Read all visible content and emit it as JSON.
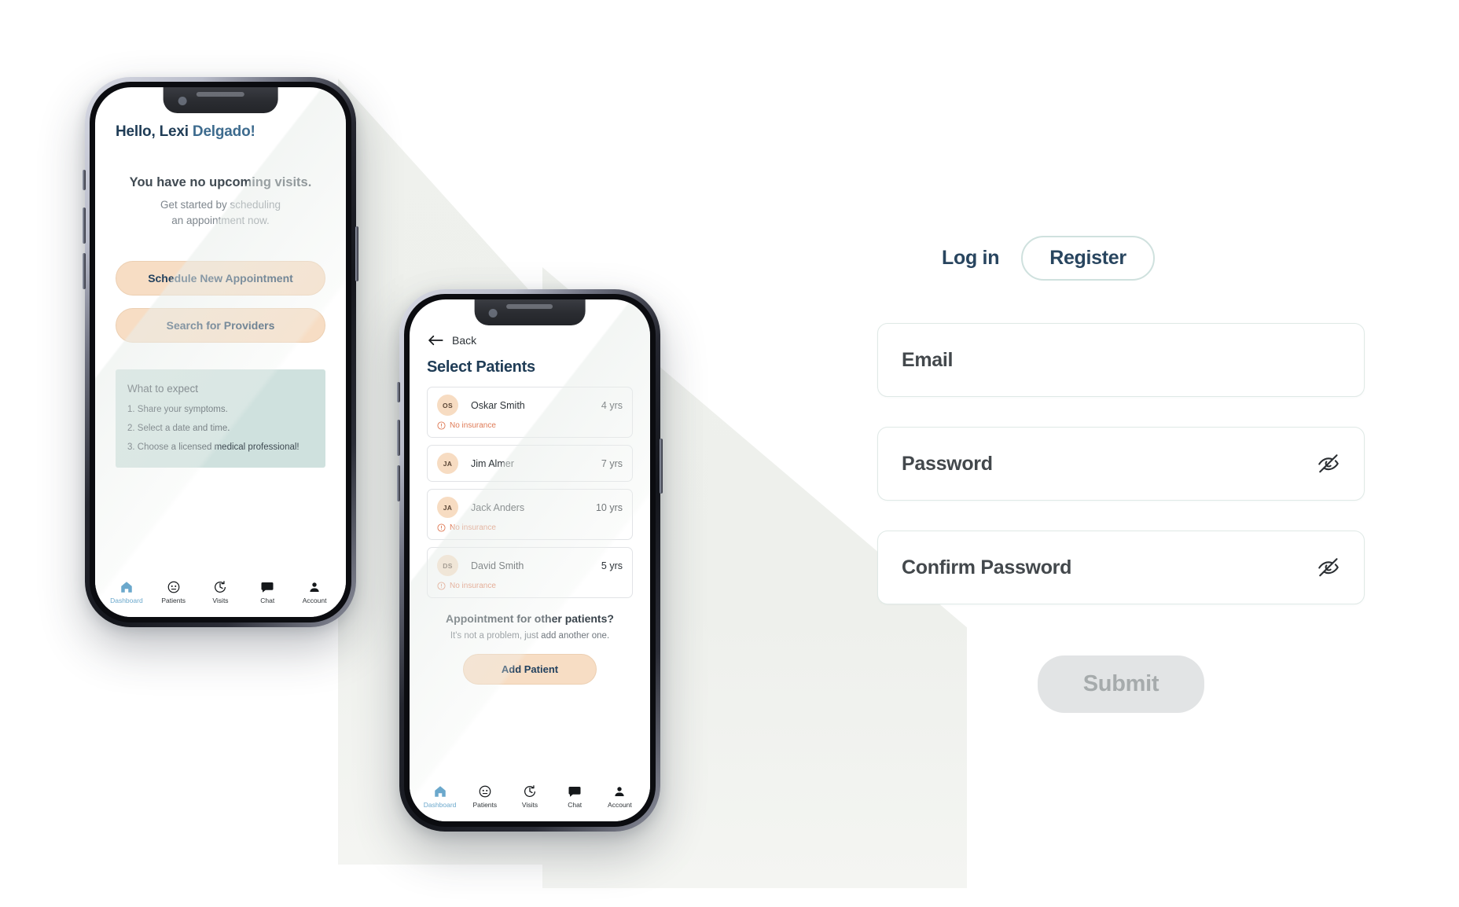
{
  "phone_dashboard": {
    "greeting_prefix": "Hello, Lexi ",
    "greeting_name": "Delgado!",
    "empty_state": {
      "title": "You have no upcoming visits.",
      "subtitle_line1": "Get started by scheduling",
      "subtitle_line2": "an appointment now."
    },
    "primary_button": "Schedule New Appointment",
    "secondary_button": "Search for Providers",
    "expect_card": {
      "title": "What to expect",
      "steps": [
        "1. Share your symptoms.",
        "2. Select a date and time.",
        "3. Choose a licensed medical professional!"
      ]
    }
  },
  "phone_patients": {
    "back_label": "Back",
    "title": "Select Patients",
    "patients": [
      {
        "initials": "OS",
        "name": "Oskar Smith",
        "age": "4 yrs",
        "insurance_warning": "No insurance"
      },
      {
        "initials": "JA",
        "name": "Jim Almer",
        "age": "7 yrs",
        "insurance_warning": ""
      },
      {
        "initials": "JA",
        "name": "Jack Anders",
        "age": "10 yrs",
        "insurance_warning": "No insurance"
      },
      {
        "initials": "DS",
        "name": "David Smith",
        "age": "5 yrs",
        "insurance_warning": "No insurance"
      }
    ],
    "other_patients": {
      "title": "Appointment for other patients?",
      "subtitle": "It's not a problem, just add another one.",
      "button": "Add Patient"
    }
  },
  "bottom_nav": {
    "items": [
      {
        "label": "Dashboard",
        "icon": "home-icon",
        "active": true
      },
      {
        "label": "Patients",
        "icon": "face-icon",
        "active": false
      },
      {
        "label": "Visits",
        "icon": "history-icon",
        "active": false
      },
      {
        "label": "Chat",
        "icon": "chat-icon",
        "active": false
      },
      {
        "label": "Account",
        "icon": "person-icon",
        "active": false
      }
    ]
  },
  "auth": {
    "tab_login": "Log in",
    "tab_register": "Register",
    "active_tab": "Register",
    "fields": [
      {
        "label": "Email",
        "value": "",
        "toggle_icon": ""
      },
      {
        "label": "Password",
        "value": "",
        "toggle_icon": "eye-off-icon"
      },
      {
        "label": "Confirm Password",
        "value": "",
        "toggle_icon": "eye-off-icon"
      }
    ],
    "submit_label": "Submit",
    "submit_disabled": true
  },
  "colors": {
    "brand_navy": "#1f3c56",
    "accent_peach": "#f7ddc4",
    "accent_teal": "#cfe1de",
    "warning_orange": "#df7b57",
    "nav_active_blue": "#6ba8cc",
    "disabled_grey": "#e2e4e5"
  }
}
